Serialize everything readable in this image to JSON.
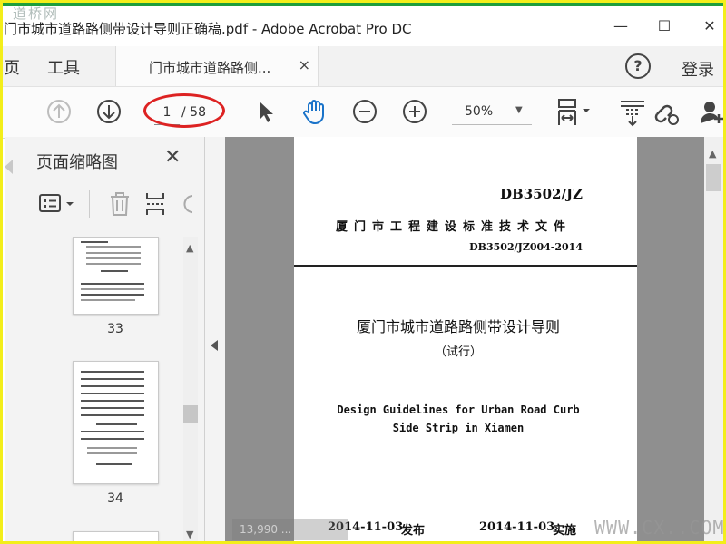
{
  "window": {
    "title": "门市城市道路路侧带设计导则正确稿.pdf - Adobe Acrobat Pro DC",
    "minimize": "—",
    "maximize": "☐",
    "close": "✕"
  },
  "watermark_top": "道桥网",
  "tabs": {
    "home_partial": "页",
    "tools": "工具",
    "document": "门市城市道路路侧...",
    "close": "×"
  },
  "header": {
    "help": "?",
    "login": "登录"
  },
  "toolbar": {
    "page_current": "1",
    "page_total": "/ 58",
    "zoom": "50%",
    "icons": [
      "page-up-icon",
      "page-down-icon",
      "select-cursor-icon",
      "hand-tool-icon",
      "zoom-out-icon",
      "zoom-in-icon",
      "fit-page-icon",
      "scroll-mode-icon",
      "link-icon",
      "share-user-icon"
    ]
  },
  "sidebar": {
    "title": "页面缩略图",
    "close": "✕",
    "thumbnails": [
      {
        "number": "33"
      },
      {
        "number": "34"
      }
    ]
  },
  "document_page": {
    "code": "DB3502/JZ",
    "doc_type": "厦门市工程建设标准技术文件",
    "standard_no": "DB3502/JZ004-2014",
    "title_cn": "厦门市城市道路路侧带设计导则",
    "subtitle_cn": "（试行）",
    "title_en_line1": "Design Guidelines for Urban Road Curb",
    "title_en_line2": "Side Strip in Xiamen",
    "publish_date": "2014-11-03",
    "publish_label": "发布",
    "effective_date": "2014-11-03",
    "effective_label": "实施"
  },
  "watermark_bottom_left": "13,990 ...",
  "watermark_site": "WWW.CX..COM",
  "colors": {
    "frame": "#f3ee1a",
    "accent_blue": "#1a73c9",
    "annotation": "#dd2222"
  }
}
